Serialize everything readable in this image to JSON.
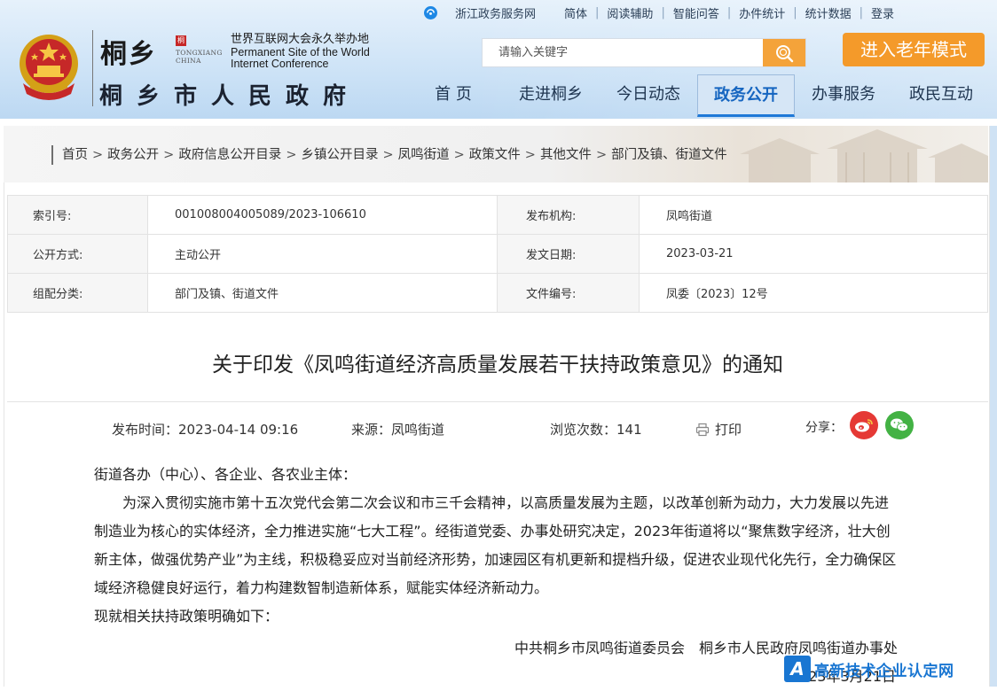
{
  "topbar": {
    "links": [
      "浙江政务服务网",
      "简体",
      "阅读辅助",
      "智能问答",
      "办件统计",
      "统计数据",
      "登录"
    ]
  },
  "logo": {
    "chinese": "桐乡",
    "english_line1": "TONGXIANG",
    "english_line2": "CHINA",
    "wic_cn": "世界互联网大会永久举办地",
    "wic_en_line1": "Permanent Site of the World",
    "wic_en_line2": "Internet Conference",
    "site_name": "桐乡市人民政府"
  },
  "search": {
    "placeholder": "请输入关键字"
  },
  "elder_mode": {
    "label": "进入老年模式"
  },
  "nav": {
    "items": [
      "首 页",
      "走进桐乡",
      "今日动态",
      "政务公开",
      "办事服务",
      "政民互动"
    ],
    "active": "政务公开"
  },
  "breadcrumb": [
    "首页",
    "政务公开",
    "政府信息公开目录",
    "乡镇公开目录",
    "凤鸣街道",
    "政策文件",
    "其他文件",
    "部门及镇、街道文件"
  ],
  "meta": {
    "index_label": "索引号:",
    "index_value": "001008004005089/2023-106610",
    "publisher_label": "发布机构:",
    "publisher_value": "凤鸣街道",
    "disclosure_label": "公开方式:",
    "disclosure_value": "主动公开",
    "issue_date_label": "发文日期:",
    "issue_date_value": "2023-03-21",
    "category_label": "组配分类:",
    "category_value": "部门及镇、街道文件",
    "doc_number_label": "文件编号:",
    "doc_number_value": "凤委〔2023〕12号"
  },
  "article": {
    "title": "关于印发《凤鸣街道经济高质量发展若干扶持政策意见》的通知",
    "publish_time": "发布时间：2023-04-14 09:16",
    "source": "来源：凤鸣街道",
    "views": "浏览次数：141",
    "print_label": "打印",
    "share_label": "分享：",
    "salutation": "街道各办（中心）、各企业、各农业主体：",
    "paragraph1": "为深入贯彻实施市第十五次党代会第二次会议和市三千会精神，以高质量发展为主题，以改革创新为动力，大力发展以先进制造业为核心的实体经济，全力推进实施“七大工程”。经街道党委、办事处研究决定，2023年街道将以“聚焦数字经济，壮大创新主体，做强优势产业”为主线，积极稳妥应对当前经济形势，加速园区有机更新和提档升级，促进农业现代化先行，全力确保区域经济稳健良好运行，着力构建数智制造新体系，赋能实体经济新动力。",
    "paragraph2": "现就相关扶持政策明确如下：",
    "signature": "中共桐乡市凤鸣街道委员会　桐乡市人民政府凤鸣街道办事处",
    "date": "2023年3月21日"
  },
  "watermark": {
    "logo": "A",
    "text": "高新技术企业认定网"
  },
  "colors": {
    "accent": "#1e78d7",
    "orange": "#f49a2a",
    "weibo": "#e53935",
    "wechat": "#43b244"
  }
}
